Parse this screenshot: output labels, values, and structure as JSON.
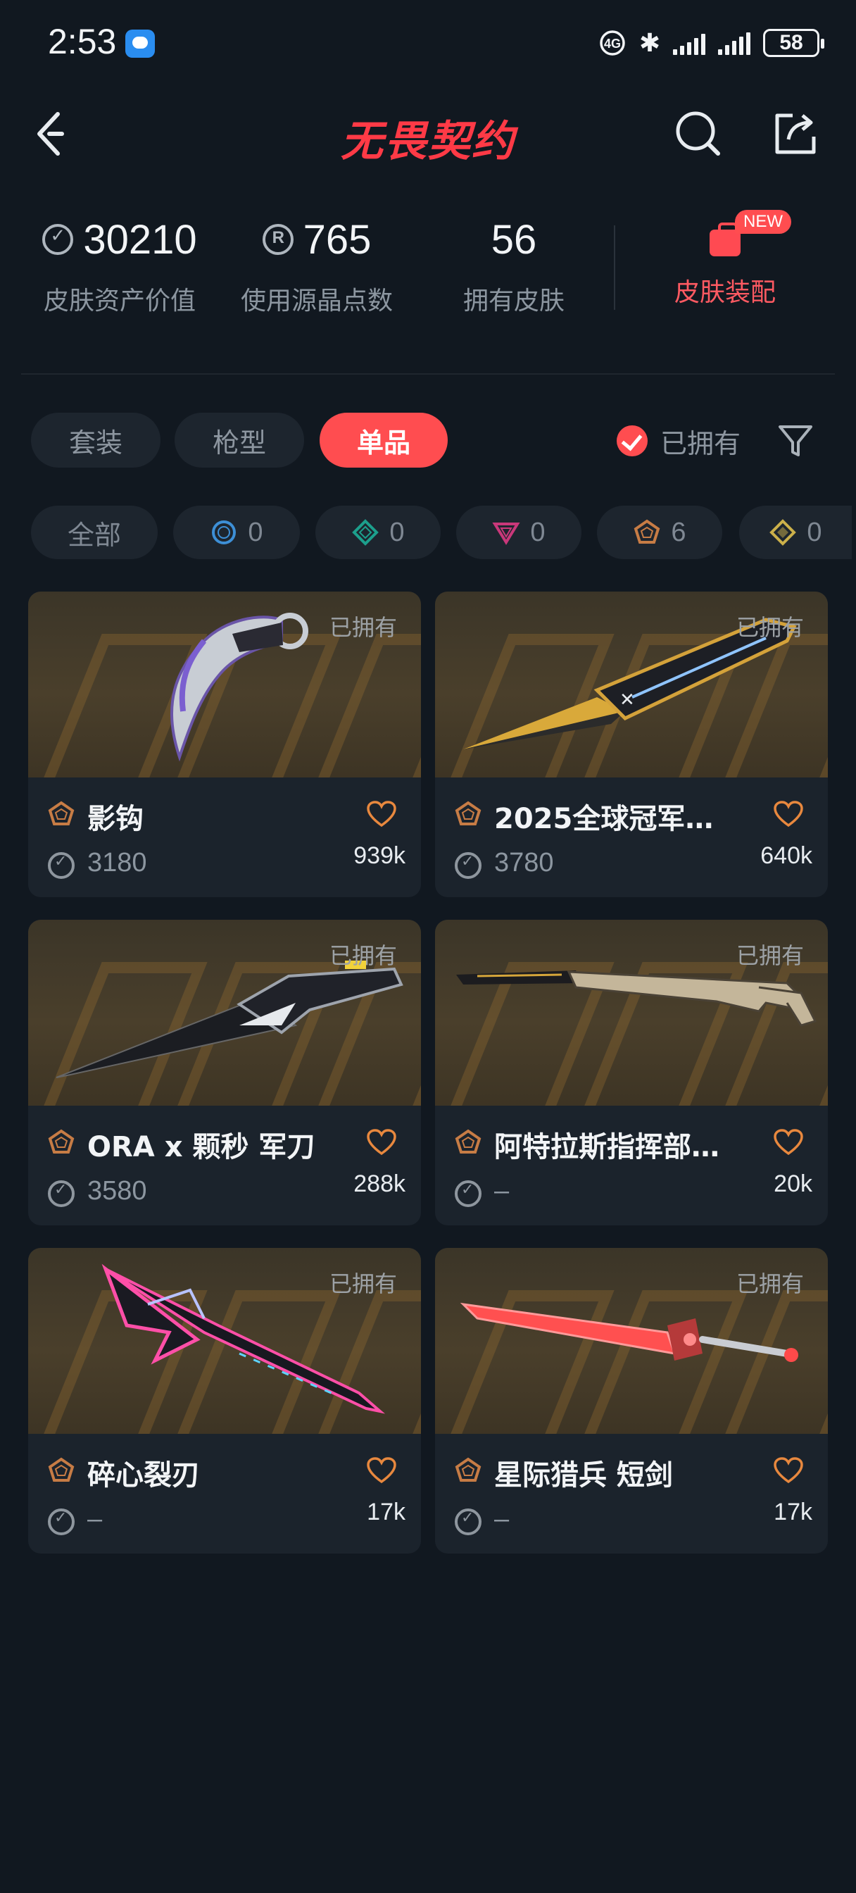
{
  "status_bar": {
    "time": "2:53",
    "network": "4G",
    "battery": "58"
  },
  "header": {
    "title": "无畏契约"
  },
  "stats": {
    "asset_value": {
      "value": "30210",
      "label": "皮肤资产价值"
    },
    "radianite_used": {
      "value": "765",
      "label": "使用源晶点数"
    },
    "skins_owned": {
      "value": "56",
      "label": "拥有皮肤"
    },
    "loadout": {
      "label": "皮肤装配",
      "badge": "NEW"
    }
  },
  "tabs": [
    "套装",
    "枪型",
    "单品"
  ],
  "active_tab": "单品",
  "owned_filter": {
    "label": "已拥有",
    "checked": true
  },
  "rarity_chips": [
    {
      "label": "全部"
    },
    {
      "count": "0",
      "color": "#3d8fd6"
    },
    {
      "count": "0",
      "color": "#1c9f8c"
    },
    {
      "count": "0",
      "color": "#c9387a"
    },
    {
      "count": "6",
      "color": "#c77c45"
    },
    {
      "count": "0",
      "color": "#cbb04a"
    }
  ],
  "colors": {
    "accent": "#ff4d50",
    "background": "#111820",
    "card": "#1b232c"
  },
  "cards": [
    {
      "owned": "已拥有",
      "name": "影钩",
      "price": "3180",
      "likes": "939k"
    },
    {
      "owned": "已拥有",
      "name": "2025全球冠军…",
      "price": "3780",
      "likes": "640k"
    },
    {
      "owned": "已拥有",
      "name": "ORA x 颗秒 军刀",
      "price": "3580",
      "likes": "288k"
    },
    {
      "owned": "已拥有",
      "name": "阿特拉斯指挥部…",
      "price": "–",
      "likes": "20k"
    },
    {
      "owned": "已拥有",
      "name": "碎心裂刃",
      "price": "–",
      "likes": "17k"
    },
    {
      "owned": "已拥有",
      "name": "星际猎兵 短剑",
      "price": "–",
      "likes": "17k"
    }
  ]
}
